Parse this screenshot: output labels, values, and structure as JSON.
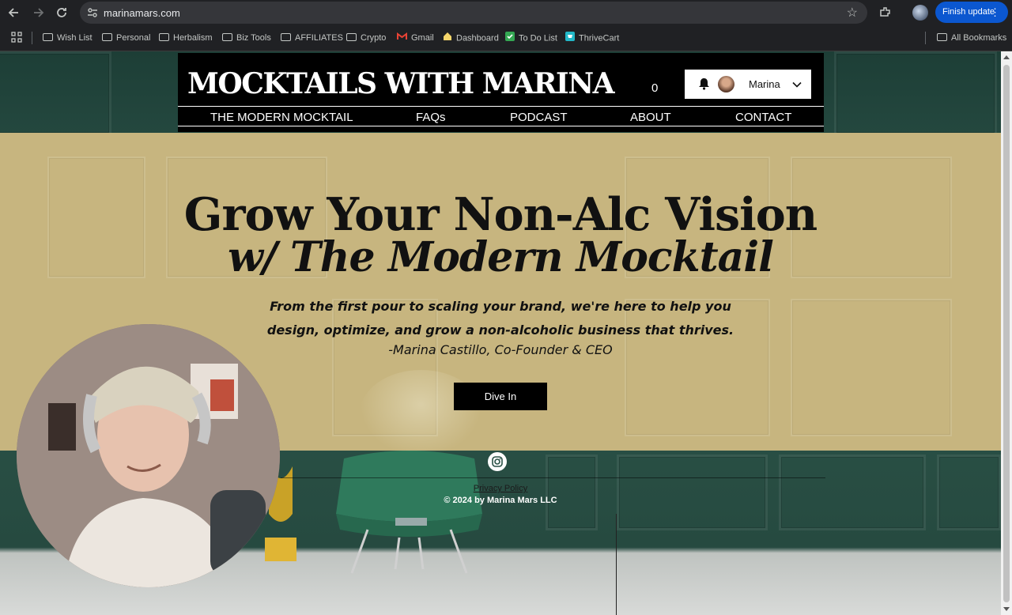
{
  "browser": {
    "url": "marinamars.com",
    "finish_update_label": "Finish update",
    "bookmarks": [
      "Wish List",
      "Personal",
      "Herbalism",
      "Biz Tools",
      "AFFILIATES",
      "Crypto",
      "Gmail",
      "Dashboard",
      "To Do List",
      "ThriveCart"
    ],
    "all_bookmarks_label": "All Bookmarks"
  },
  "site": {
    "logo": "MOCKTAILS WITH MARINA",
    "cart_count": "0",
    "user_name": "Marina",
    "nav": [
      "THE MODERN MOCKTAIL",
      "FAQs",
      "PODCAST",
      "ABOUT",
      "CONTACT"
    ]
  },
  "hero": {
    "title_line1": "Grow Your Non-Alc Vision",
    "title_line2": "w/ The Modern Mocktail",
    "quote_line1": "From the first pour to scaling your brand, we're here to help you",
    "quote_line2": "design, optimize, and grow a non-alcoholic business that thrives.",
    "signature": "-Marina Castillo, Co-Founder & CEO",
    "cta_label": "Dive In"
  },
  "footer": {
    "privacy_label": "Privacy Policy",
    "copyright": "© 2024 by Marina Mars LLC"
  },
  "colors": {
    "hero_bg": "#c7b57f",
    "wall": "#2a5146",
    "header_bg": "#000000",
    "chrome_accent": "#0b57d0"
  },
  "icons": [
    "back-icon",
    "forward-icon",
    "reload-icon",
    "site-info-icon",
    "star-icon",
    "extensions-icon",
    "apps-icon",
    "folder-icon",
    "gmail-icon",
    "dashboard-icon",
    "todo-icon",
    "thrivecart-icon",
    "bell-icon",
    "chevron-down-icon",
    "instagram-icon"
  ]
}
